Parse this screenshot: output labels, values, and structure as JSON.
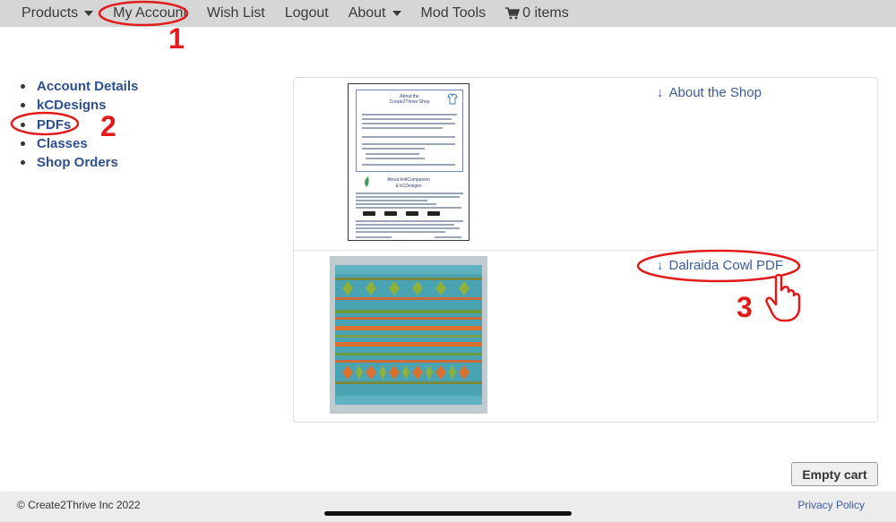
{
  "nav": {
    "items": [
      {
        "label": "Products",
        "caret": true
      },
      {
        "label": "My Account",
        "caret": false
      },
      {
        "label": "Wish List",
        "caret": false
      },
      {
        "label": "Logout",
        "caret": false
      },
      {
        "label": "About",
        "caret": true
      },
      {
        "label": "Mod Tools",
        "caret": false
      }
    ],
    "cart_label": "0 items",
    "cart_icon": "cart-icon"
  },
  "sidebar": {
    "items": [
      {
        "label": "Account Details"
      },
      {
        "label": "kCDesigns"
      },
      {
        "label": "PDFs"
      },
      {
        "label": "Classes"
      },
      {
        "label": "Shop Orders"
      }
    ]
  },
  "downloads": [
    {
      "arrow": "↓",
      "label": "About the Shop",
      "thumb": "document-thumbnail"
    },
    {
      "arrow": "↓",
      "label": "Dalraida Cowl PDF",
      "thumb": "knitted-cowl-photo"
    }
  ],
  "doc_thumb": {
    "title1": "About the",
    "title2": "Create2Thrive Shop",
    "title3": "About knitCompanion",
    "title4": "& kCDesigns"
  },
  "empty_cart_label": "Empty cart",
  "footer": {
    "copyright": "© Create2Thrive Inc 2022",
    "privacy": "Privacy Policy"
  },
  "annotations": [
    "1",
    "2",
    "3"
  ],
  "colors": {
    "link": "#3a5a9c",
    "annotation": "#e21a1a",
    "nav_bg": "#d6d6d6"
  }
}
